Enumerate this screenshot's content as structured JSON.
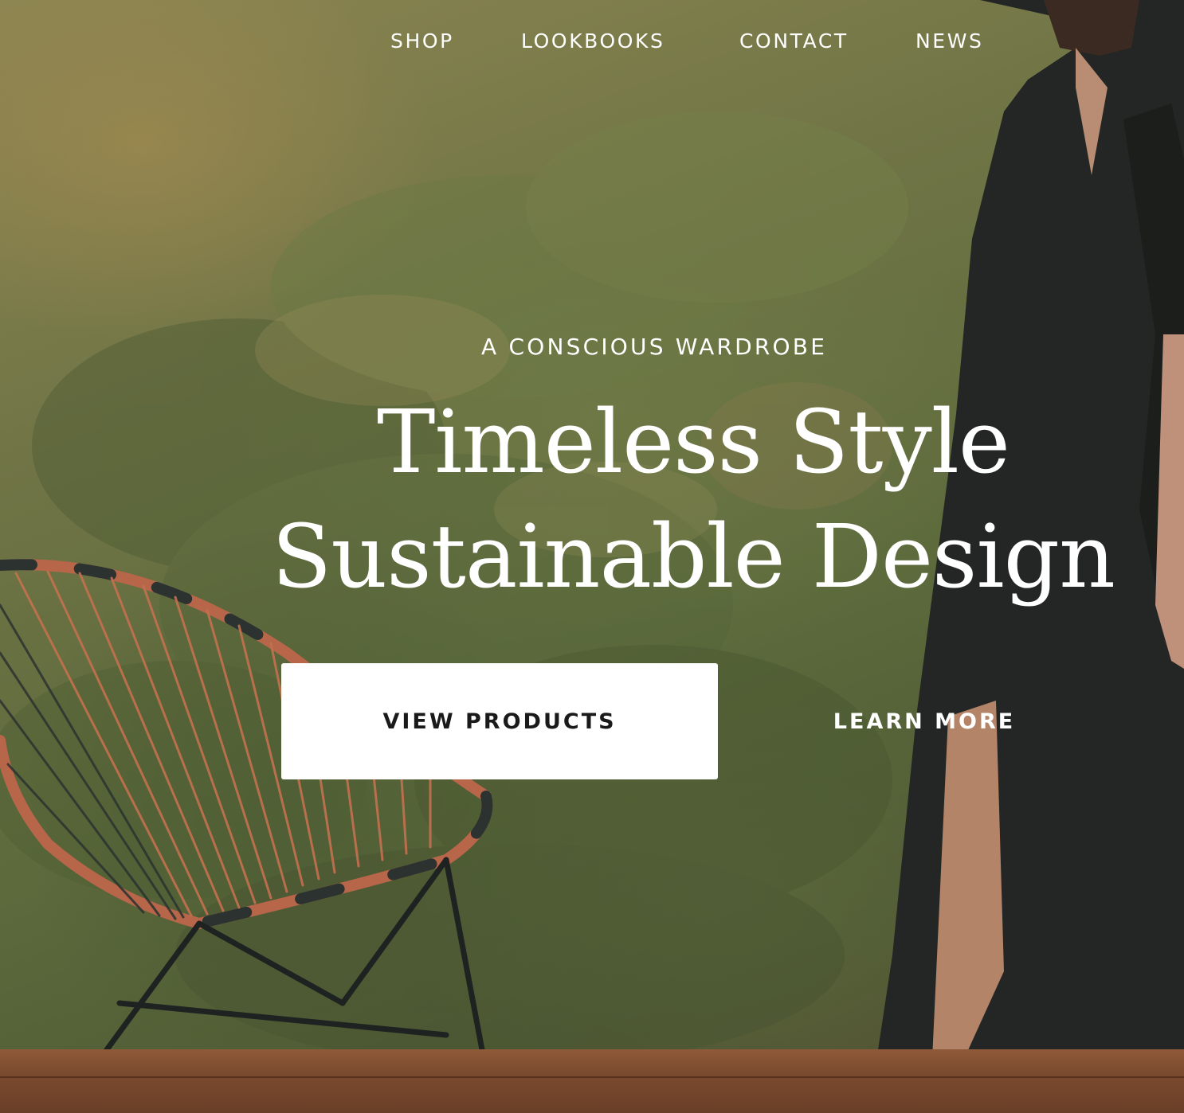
{
  "nav": {
    "items": [
      {
        "label": "SHOP"
      },
      {
        "label": "LOOKBOOKS"
      },
      {
        "label": "CONTACT"
      },
      {
        "label": "NEWS"
      }
    ]
  },
  "hero": {
    "eyebrow": "A CONSCIOUS WARDROBE",
    "headline_line1": "Timeless Style",
    "headline_line2": "Sustainable Design",
    "primary_cta": "VIEW PRODUCTS",
    "secondary_cta": "LEARN MORE"
  },
  "colors": {
    "text_on_image": "#ffffff",
    "primary_button_bg": "#ffffff",
    "primary_button_text": "#1a1a1a"
  }
}
